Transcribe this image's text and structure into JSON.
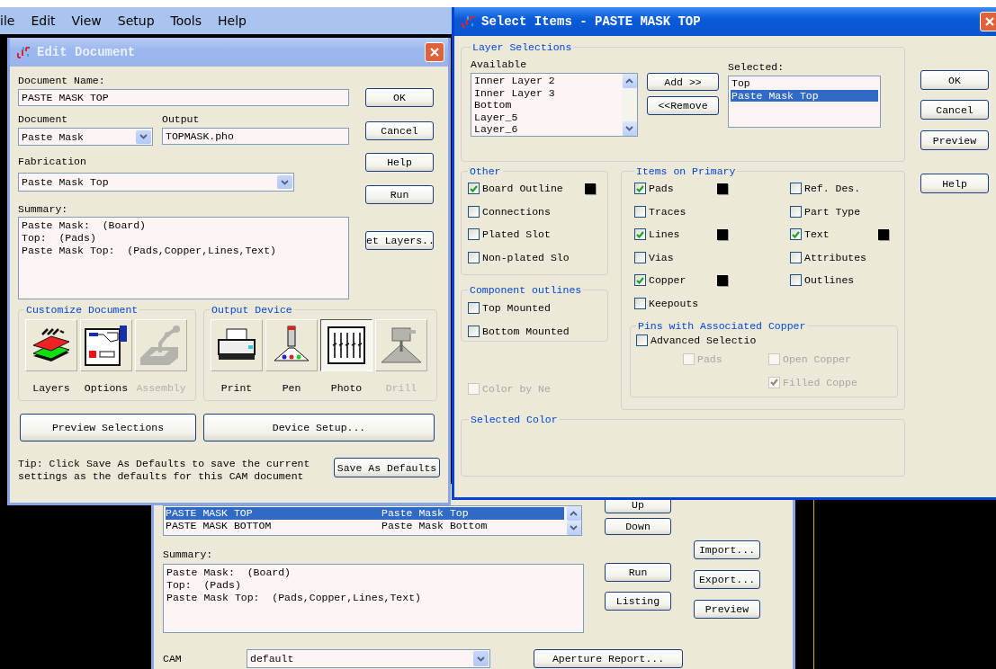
{
  "menu_bar": {
    "items": [
      "ile",
      "Edit",
      "View",
      "Setup",
      "Tools",
      "Help"
    ]
  },
  "cam_window": {
    "documents": [
      {
        "name": "PASTE MASK TOP",
        "fabrication": "Paste Mask Top",
        "selected": true
      },
      {
        "name": "PASTE MASK BOTTOM",
        "fabrication": "Paste Mask Bottom",
        "selected": false
      }
    ],
    "move_buttons": [
      "Up",
      "Down"
    ],
    "summary_label": "Summary:",
    "summary": [
      "Paste Mask:  (Board)",
      "Top:  (Pads)",
      "Paste Mask Top:  (Pads,Copper,Lines,Text)"
    ],
    "action_buttons": [
      "Run",
      "Listing"
    ],
    "file_buttons": [
      "Import...",
      "Export...",
      "Preview"
    ],
    "cam_label": "CAM",
    "cam_value": "default",
    "aperture_button": "Aperture Report..."
  },
  "edit_document": {
    "title": "Edit Document",
    "name_label": "Document Name:",
    "name_value": "PASTE MASK TOP",
    "document_label": "Document",
    "document_value": "Paste Mask",
    "output_label": "Output",
    "output_value": "TOPMASK.pho",
    "fabrication_label": "Fabrication",
    "fabrication_value": "Paste Mask Top",
    "summary_label": "Summary:",
    "summary": [
      "Paste Mask:  (Board)",
      "Top:  (Pads)",
      "Paste Mask Top:  (Pads,Copper,Lines,Text)"
    ],
    "buttons": [
      "OK",
      "Cancel",
      "Help",
      "Run",
      "et Layers.."
    ],
    "customize": {
      "title": "Customize Document",
      "items": [
        {
          "kind": "layers",
          "label": "Layers",
          "disabled": false
        },
        {
          "kind": "options",
          "label": "Options",
          "disabled": false
        },
        {
          "kind": "assembly",
          "label": "Assembly",
          "disabled": true
        }
      ]
    },
    "output_device": {
      "title": "Output Device",
      "items": [
        {
          "kind": "print",
          "label": "Print",
          "disabled": false,
          "selected": false
        },
        {
          "kind": "pen",
          "label": "Pen",
          "disabled": false,
          "selected": false
        },
        {
          "kind": "photo",
          "label": "Photo",
          "disabled": false,
          "selected": true
        },
        {
          "kind": "drill",
          "label": "Drill",
          "disabled": true,
          "selected": false
        }
      ]
    },
    "preview_button": "Preview Selections",
    "device_setup_button": "Device Setup...",
    "tip": [
      "Tip: Click Save As Defaults to save the current",
      "settings as the defaults for this CAM document"
    ],
    "save_defaults_button": "Save As Defaults"
  },
  "select_items": {
    "title": "Select Items - PASTE MASK TOP",
    "layer_selections": {
      "title": "Layer Selections",
      "available_label": "Available",
      "available": [
        "Inner Layer 2",
        "Inner Layer 3",
        "Bottom",
        "Layer_5",
        "Layer_6"
      ],
      "add_button": "Add >>",
      "remove_button": "<<Remove",
      "selected_label": "Selected:",
      "selected": [
        {
          "label": "Top",
          "selected": false
        },
        {
          "label": "Paste Mask Top",
          "selected": true
        }
      ]
    },
    "buttons": [
      "OK",
      "Cancel",
      "Preview",
      "Help"
    ],
    "other": {
      "title": "Other",
      "items": [
        {
          "label": "Board Outline",
          "checked": true,
          "color": "#000000"
        },
        {
          "label": "Connections",
          "checked": false
        },
        {
          "label": "Plated Slot",
          "checked": false
        },
        {
          "label": "Non-plated Slo",
          "checked": false
        }
      ]
    },
    "component_outlines": {
      "title": "Component outlines",
      "items": [
        {
          "label": "Top Mounted",
          "checked": false
        },
        {
          "label": "Bottom Mounted",
          "checked": false
        }
      ]
    },
    "color_by_net": {
      "label": "Color by Ne",
      "checked": false,
      "disabled": true
    },
    "items_on_primary": {
      "title": "Items on Primary",
      "columns": [
        [
          {
            "label": "Pads",
            "checked": true,
            "color": "#000000"
          },
          {
            "label": "Traces",
            "checked": false
          },
          {
            "label": "Lines",
            "checked": true,
            "color": "#000000"
          },
          {
            "label": "Vias",
            "checked": false
          },
          {
            "label": "Copper",
            "checked": true,
            "color": "#000000"
          },
          {
            "label": "Keepouts",
            "checked": false
          }
        ],
        [
          {
            "label": "Ref. Des.",
            "checked": false
          },
          {
            "label": "Part Type",
            "checked": false
          },
          {
            "label": "Text",
            "checked": true,
            "color": "#000000"
          },
          {
            "label": "Attributes",
            "checked": false
          },
          {
            "label": "Outlines",
            "checked": false
          }
        ]
      ]
    },
    "pins": {
      "title": "Pins with Associated Copper",
      "advanced": {
        "label": "Advanced Selectio",
        "checked": false
      },
      "items": [
        {
          "label": "Pads",
          "checked": false,
          "disabled": true
        },
        {
          "label": "Open Copper",
          "checked": false,
          "disabled": true
        },
        {
          "label": "Filled Coppe",
          "checked": true,
          "disabled": true
        }
      ]
    },
    "selected_color": {
      "title": "Selected Color"
    }
  }
}
